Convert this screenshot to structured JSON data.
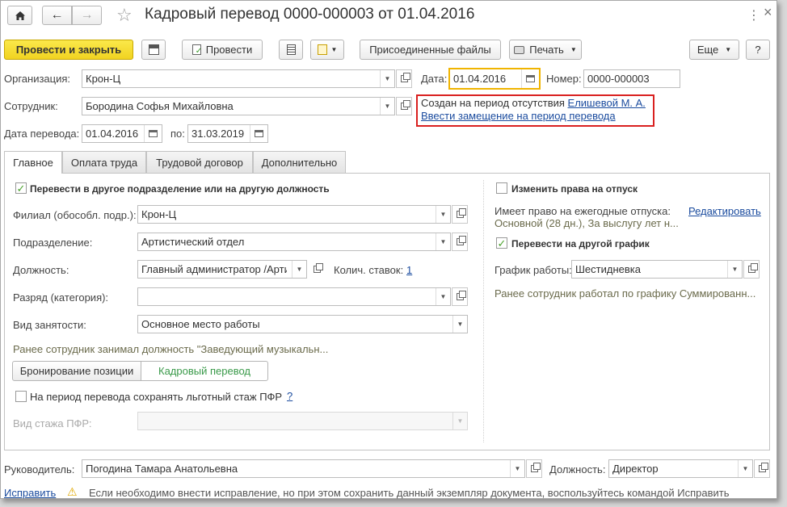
{
  "window": {
    "title": "Кадровый перевод 0000-000003 от 01.04.2016",
    "close_glyph": "×",
    "menu_glyph": "⋮"
  },
  "toolbar": {
    "post_close": "Провести и закрыть",
    "post": "Провести",
    "attached_files": "Присоединенные файлы",
    "print": "Печать",
    "more": "Еще",
    "help": "?"
  },
  "header": {
    "org_label": "Организация:",
    "org_value": "Крон-Ц",
    "date_label": "Дата:",
    "date_value": "01.04.2016",
    "number_label": "Номер:",
    "number_value": "0000-000003",
    "employee_label": "Сотрудник:",
    "employee_value": "Бородина Софья Михайловна",
    "transfer_date_label": "Дата перевода:",
    "transfer_date_value": "01.04.2016",
    "to_label": "по:",
    "to_value": "31.03.2019",
    "info_text": "Создан на период отсутствия",
    "info_link": "Елишевой М. А.",
    "replace_link": "Ввести замещение на период перевода"
  },
  "tabs": [
    {
      "label": "Главное"
    },
    {
      "label": "Оплата труда"
    },
    {
      "label": "Трудовой договор"
    },
    {
      "label": "Дополнительно"
    }
  ],
  "main": {
    "transfer_checkbox": "Перевести в другое подразделение или на другую должность",
    "branch_label": "Филиал (обособл. подр.):",
    "branch_value": "Крон-Ц",
    "division_label": "Подразделение:",
    "division_value": "Артистический отдел",
    "position_label": "Должность:",
    "position_value": "Главный администратор /Артис",
    "rates_label": "Колич. ставок:",
    "rates_value": "1",
    "grade_label": "Разряд (категория):",
    "grade_value": "",
    "employment_label": "Вид занятости:",
    "employment_value": "Основное место работы",
    "previous_position_note": "Ранее сотрудник занимал должность \"Заведующий музыкальн...",
    "booking_button": "Бронирование позиции",
    "personnel_transfer_button": "Кадровый перевод",
    "pension_checkbox": "На период перевода сохранять льготный стаж ПФР",
    "pension_help": "?",
    "pension_type_label": "Вид стажа ПФР:",
    "pension_type_value": ""
  },
  "right": {
    "vacation_checkbox": "Изменить права на отпуск",
    "vacation_rights_label": "Имеет право на ежегодные отпуска:",
    "edit_link": "Редактировать",
    "vacation_rights_value": "Основной (28 дн.), За выслугу лет н...",
    "schedule_checkbox": "Перевести на другой график",
    "schedule_label": "График работы:",
    "schedule_value": "Шестидневка",
    "previous_schedule_note": "Ранее сотрудник работал по графику Суммированн..."
  },
  "footer": {
    "manager_label": "Руководитель:",
    "manager_value": "Погодина Тамара Анатольевна",
    "position_label": "Должность:",
    "position_value": "Директор",
    "fix_link": "Исправить",
    "warning_text": "Если необходимо внести исправление, но при этом сохранить данный экземпляр документа, воспользуйтесь командой Исправить"
  },
  "colors": {
    "accent_yellow": "#f1d321",
    "link_blue": "#1a4b9e",
    "highlight_red": "#d9201f",
    "date_focus_orange": "#f0b400",
    "check_green": "#4aa22c"
  }
}
